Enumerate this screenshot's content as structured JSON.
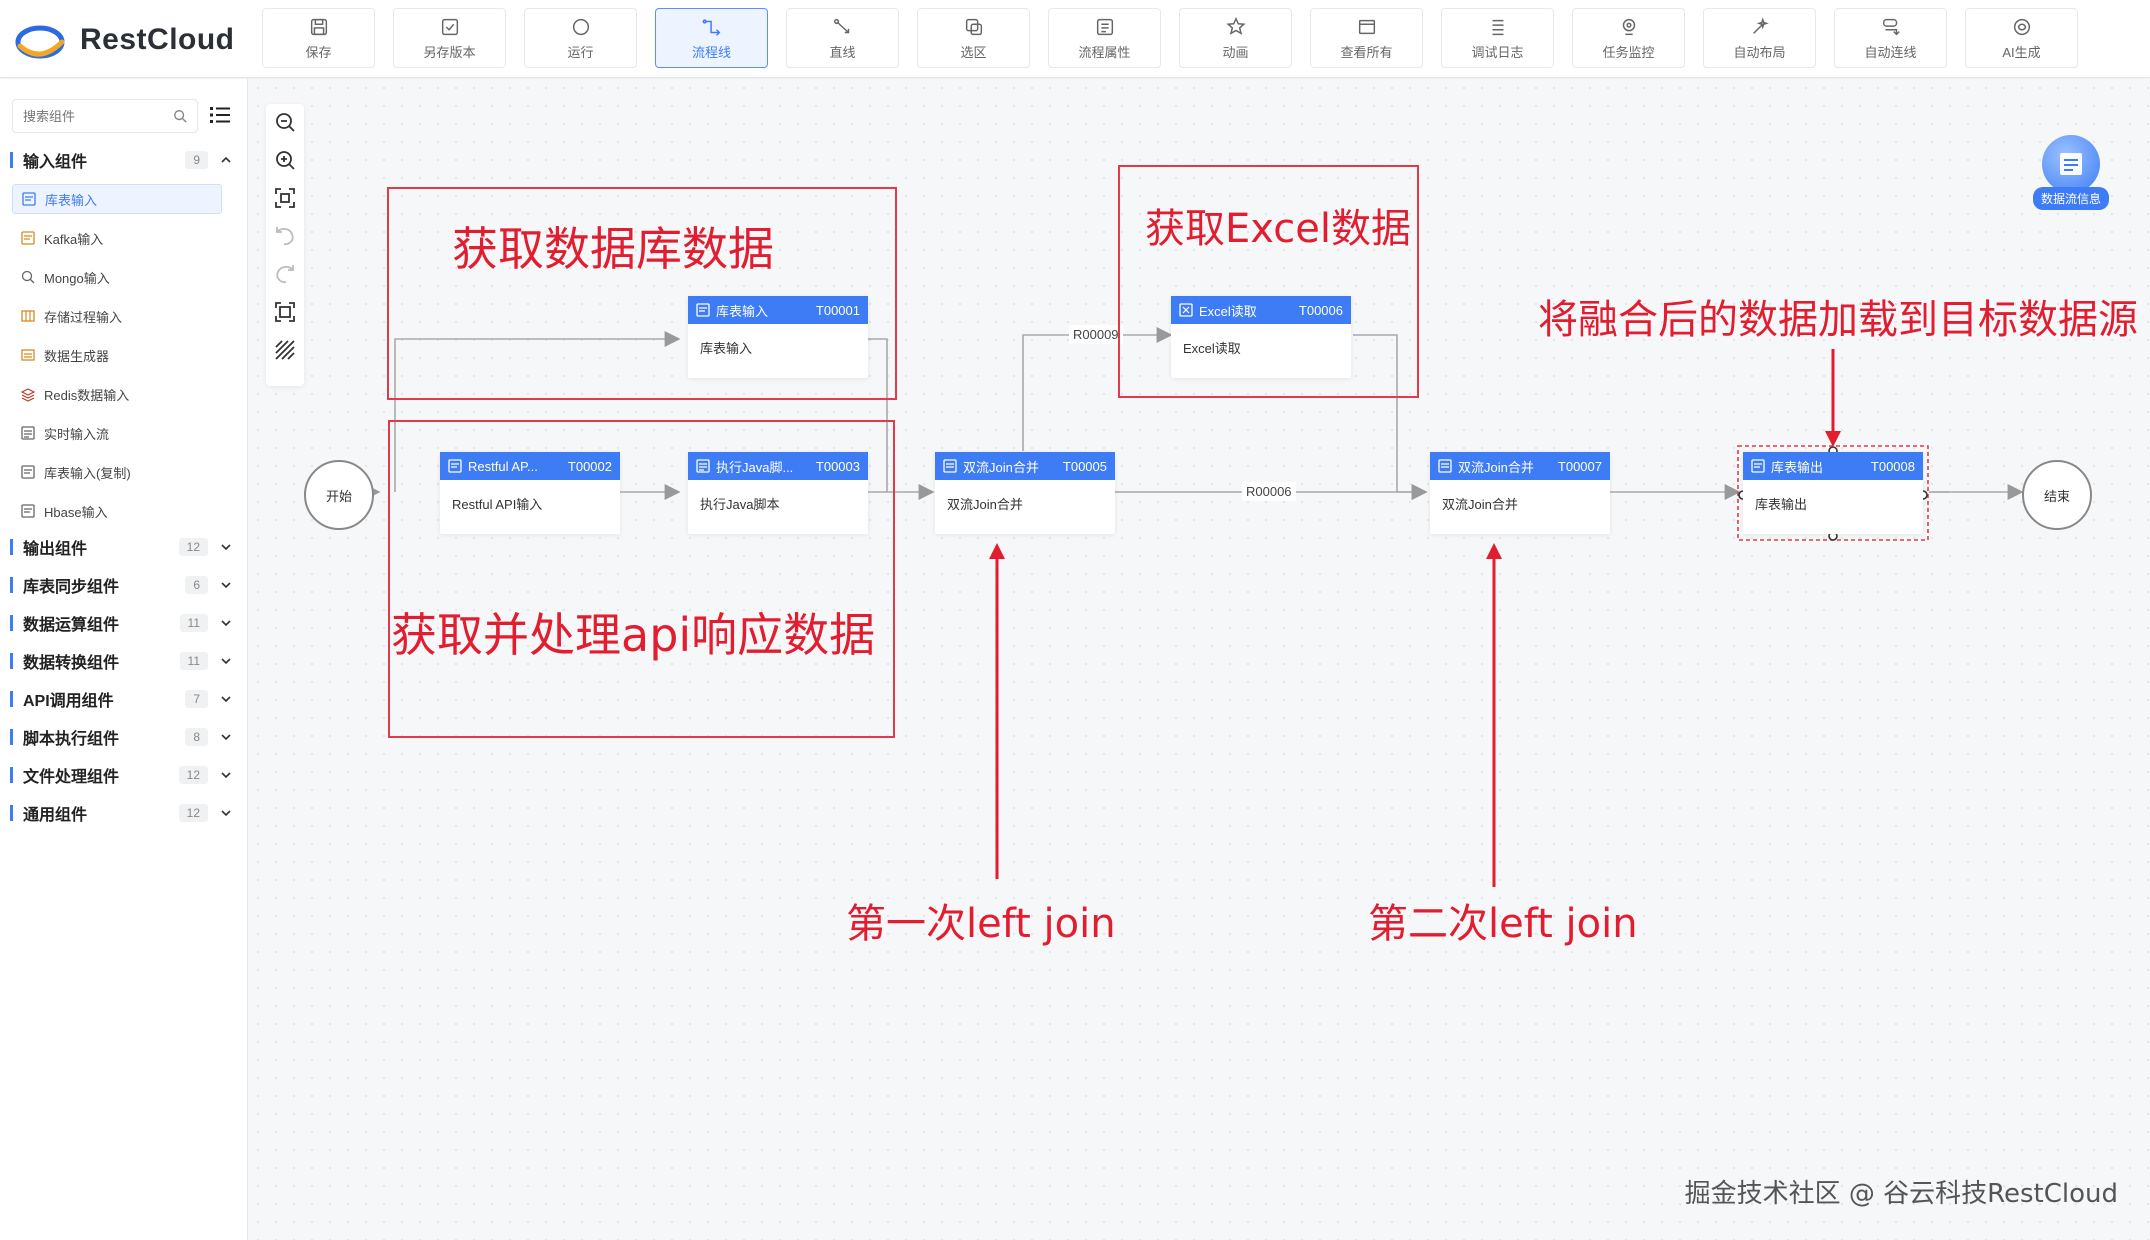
{
  "app": {
    "name": "RestCloud"
  },
  "toolbar": [
    {
      "label": "保存",
      "icon": "save-icon"
    },
    {
      "label": "另存版本",
      "icon": "save-version-icon"
    },
    {
      "label": "运行",
      "icon": "run-icon"
    },
    {
      "label": "流程线",
      "icon": "flow-line-icon",
      "active": true
    },
    {
      "label": "直线",
      "icon": "straight-line-icon"
    },
    {
      "label": "选区",
      "icon": "selection-icon"
    },
    {
      "label": "流程属性",
      "icon": "flow-properties-icon"
    },
    {
      "label": "动画",
      "icon": "animation-icon"
    },
    {
      "label": "查看所有",
      "icon": "view-all-icon"
    },
    {
      "label": "调试日志",
      "icon": "debug-log-icon"
    },
    {
      "label": "任务监控",
      "icon": "task-monitor-icon"
    },
    {
      "label": "自动布局",
      "icon": "auto-layout-icon"
    },
    {
      "label": "自动连线",
      "icon": "auto-connect-icon"
    },
    {
      "label": "AI生成",
      "icon": "ai-generate-icon"
    }
  ],
  "sidebar": {
    "search_placeholder": "搜索组件",
    "input_category": {
      "name": "输入组件",
      "count": "9"
    },
    "input_items": [
      {
        "label": "库表输入",
        "selected": true
      },
      {
        "label": "Kafka输入"
      },
      {
        "label": "Mongo输入"
      },
      {
        "label": "存储过程输入"
      },
      {
        "label": "数据生成器"
      },
      {
        "label": "Redis数据输入"
      },
      {
        "label": "实时输入流"
      },
      {
        "label": "库表输入(复制)"
      },
      {
        "label": "Hbase输入"
      }
    ],
    "categories": [
      {
        "name": "输出组件",
        "count": "12"
      },
      {
        "name": "库表同步组件",
        "count": "6"
      },
      {
        "name": "数据运算组件",
        "count": "11"
      },
      {
        "name": "数据转换组件",
        "count": "11"
      },
      {
        "name": "API调用组件",
        "count": "7"
      },
      {
        "name": "脚本执行组件",
        "count": "8"
      },
      {
        "name": "文件处理组件",
        "count": "12"
      },
      {
        "name": "通用组件",
        "count": "12"
      }
    ]
  },
  "flow": {
    "start": "开始",
    "end": "结束",
    "nodes": {
      "t1": {
        "title": "库表输入",
        "id": "T00001",
        "body": "库表输入"
      },
      "t2": {
        "title": "Restful AP...",
        "id": "T00002",
        "body": "Restful API输入"
      },
      "t3": {
        "title": "执行Java脚...",
        "id": "T00003",
        "body": "执行Java脚本"
      },
      "t5": {
        "title": "双流Join合并",
        "id": "T00005",
        "body": "双流Join合并"
      },
      "t6": {
        "title": "Excel读取",
        "id": "T00006",
        "body": "Excel读取"
      },
      "t7": {
        "title": "双流Join合并",
        "id": "T00007",
        "body": "双流Join合并"
      },
      "t8": {
        "title": "库表输出",
        "id": "T00008",
        "body": "库表输出"
      }
    },
    "edge_labels": {
      "r9": "R00009",
      "r6": "R00006"
    }
  },
  "annotations": {
    "db": "获取数据库数据",
    "api": "获取并处理api响应数据",
    "excel": "获取Excel数据",
    "load": "将融合后的数据加载到目标数据源",
    "join1": "第一次left join",
    "join2": "第二次left join"
  },
  "dataflow_info": "数据流信息",
  "watermark": "掘金技术社区 @ 谷云科技RestCloud",
  "colors": {
    "accent": "#3d7cf5",
    "annotation": "#e21d30"
  }
}
